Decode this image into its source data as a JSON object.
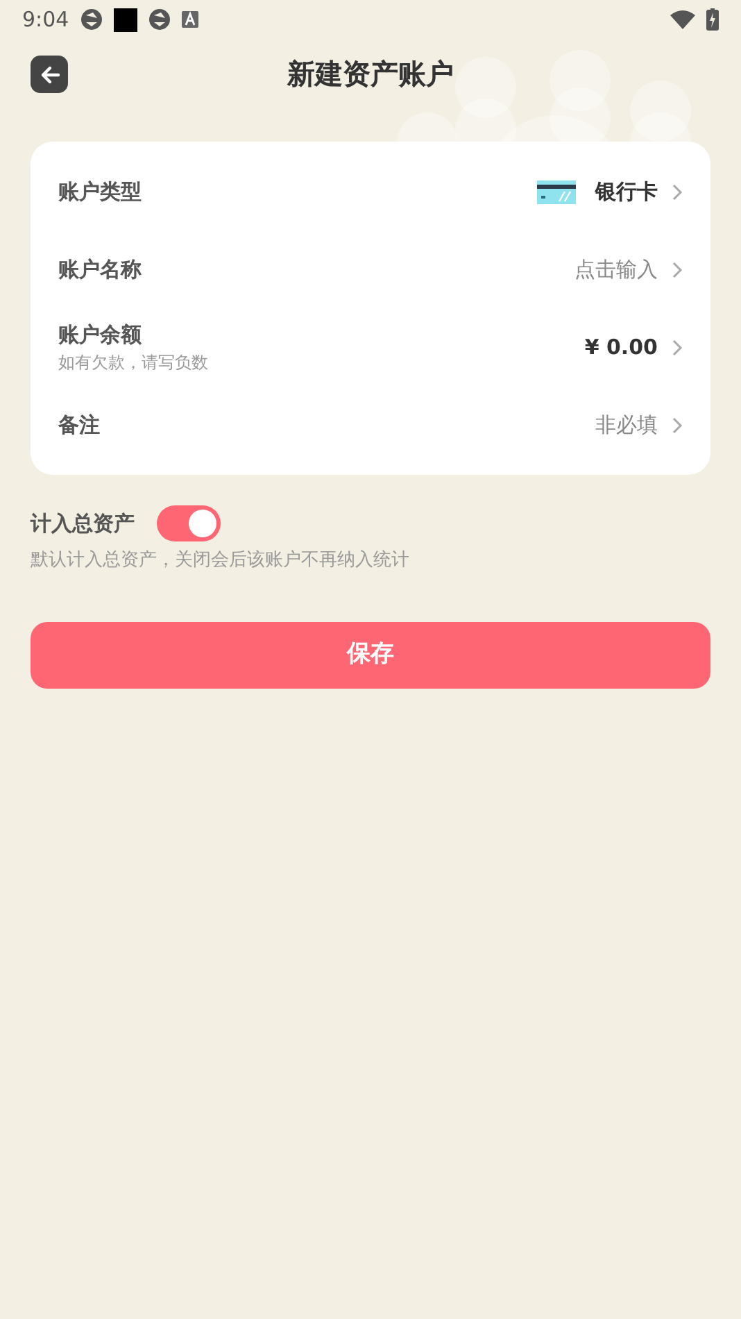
{
  "status_bar": {
    "time": "9:04"
  },
  "header": {
    "title": "新建资产账户"
  },
  "form_rows": [
    {
      "kind": "select",
      "label": "账户类型",
      "value": "银行卡"
    },
    {
      "kind": "text",
      "label": "账户名称",
      "placeholder": "点击输入"
    },
    {
      "kind": "text",
      "label": "账户余额",
      "hint": "如有欠款，请写负数",
      "value": "¥ 0.00"
    },
    {
      "kind": "text",
      "label": "备注",
      "placeholder": "非必填"
    }
  ],
  "include_total": {
    "label": "计入总资产",
    "on": true,
    "description": "默认计入总资产，关闭会后该账户不再纳入统计"
  },
  "save_button": "保存"
}
